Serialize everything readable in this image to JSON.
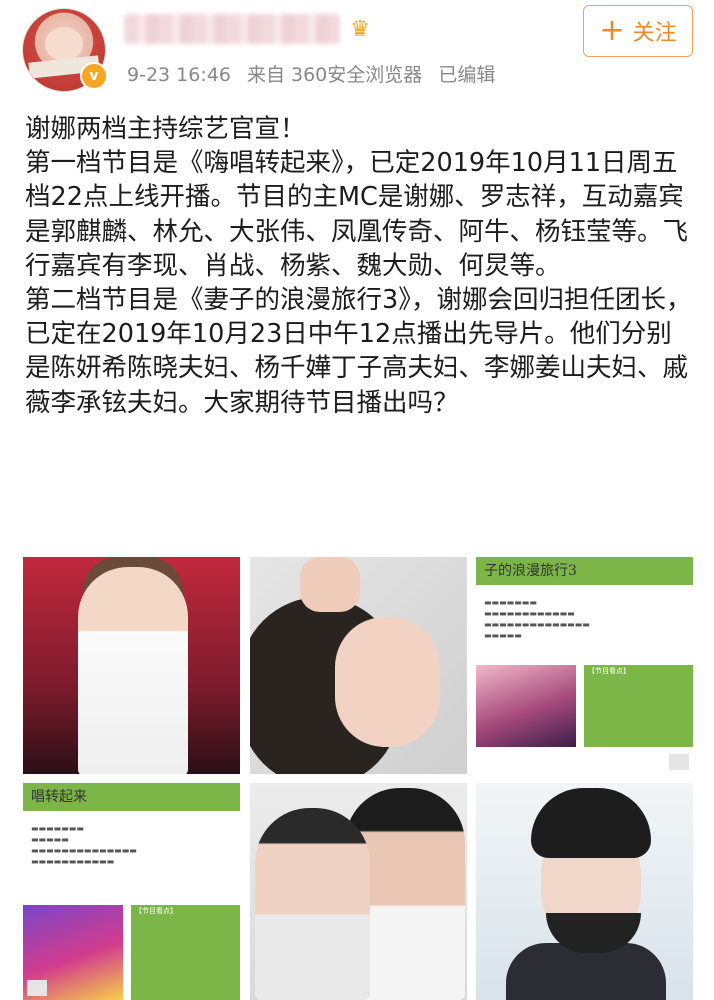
{
  "header": {
    "meta_time": "9-23 16:46",
    "meta_source": "来自 360安全浏览器",
    "meta_edited": "已编辑",
    "follow_label": "关注",
    "follow_icon": "plus-icon",
    "vip_icon": "crown-icon",
    "verified_icon": "verified-badge-icon"
  },
  "post": {
    "paragraphs": [
      "谢娜两档主持综艺官宣！",
      "第一档节目是《嗨唱转起来》，已定2019年10月11日周五档22点上线开播。节目的主MC是谢娜、罗志祥，互动嘉宾是郭麒麟、林允、大张伟、凤凰传奇、阿牛、杨钰莹等。飞行嘉宾有李现、肖战、杨紫、魏大勋、何炅等。",
      "第二档节目是《妻子的浪漫旅行3》，谢娜会回归担任团长，已定在2019年10月23日中午12点播出先导片。他们分别是陈妍希陈晓夫妇、杨千嬅丁子高夫妇、李娜姜山夫妇、戚薇李承铉夫妇。大家期待节目播出吗？"
    ]
  },
  "images": {
    "slide1_title": "子的浪漫旅行3",
    "slide1_box_header": "【节目看点】",
    "slide2_title": "唱转起来",
    "slide2_box_header": "【节目看点】"
  },
  "colors": {
    "follow": "#f08a28",
    "slide_green": "#7cb648"
  }
}
